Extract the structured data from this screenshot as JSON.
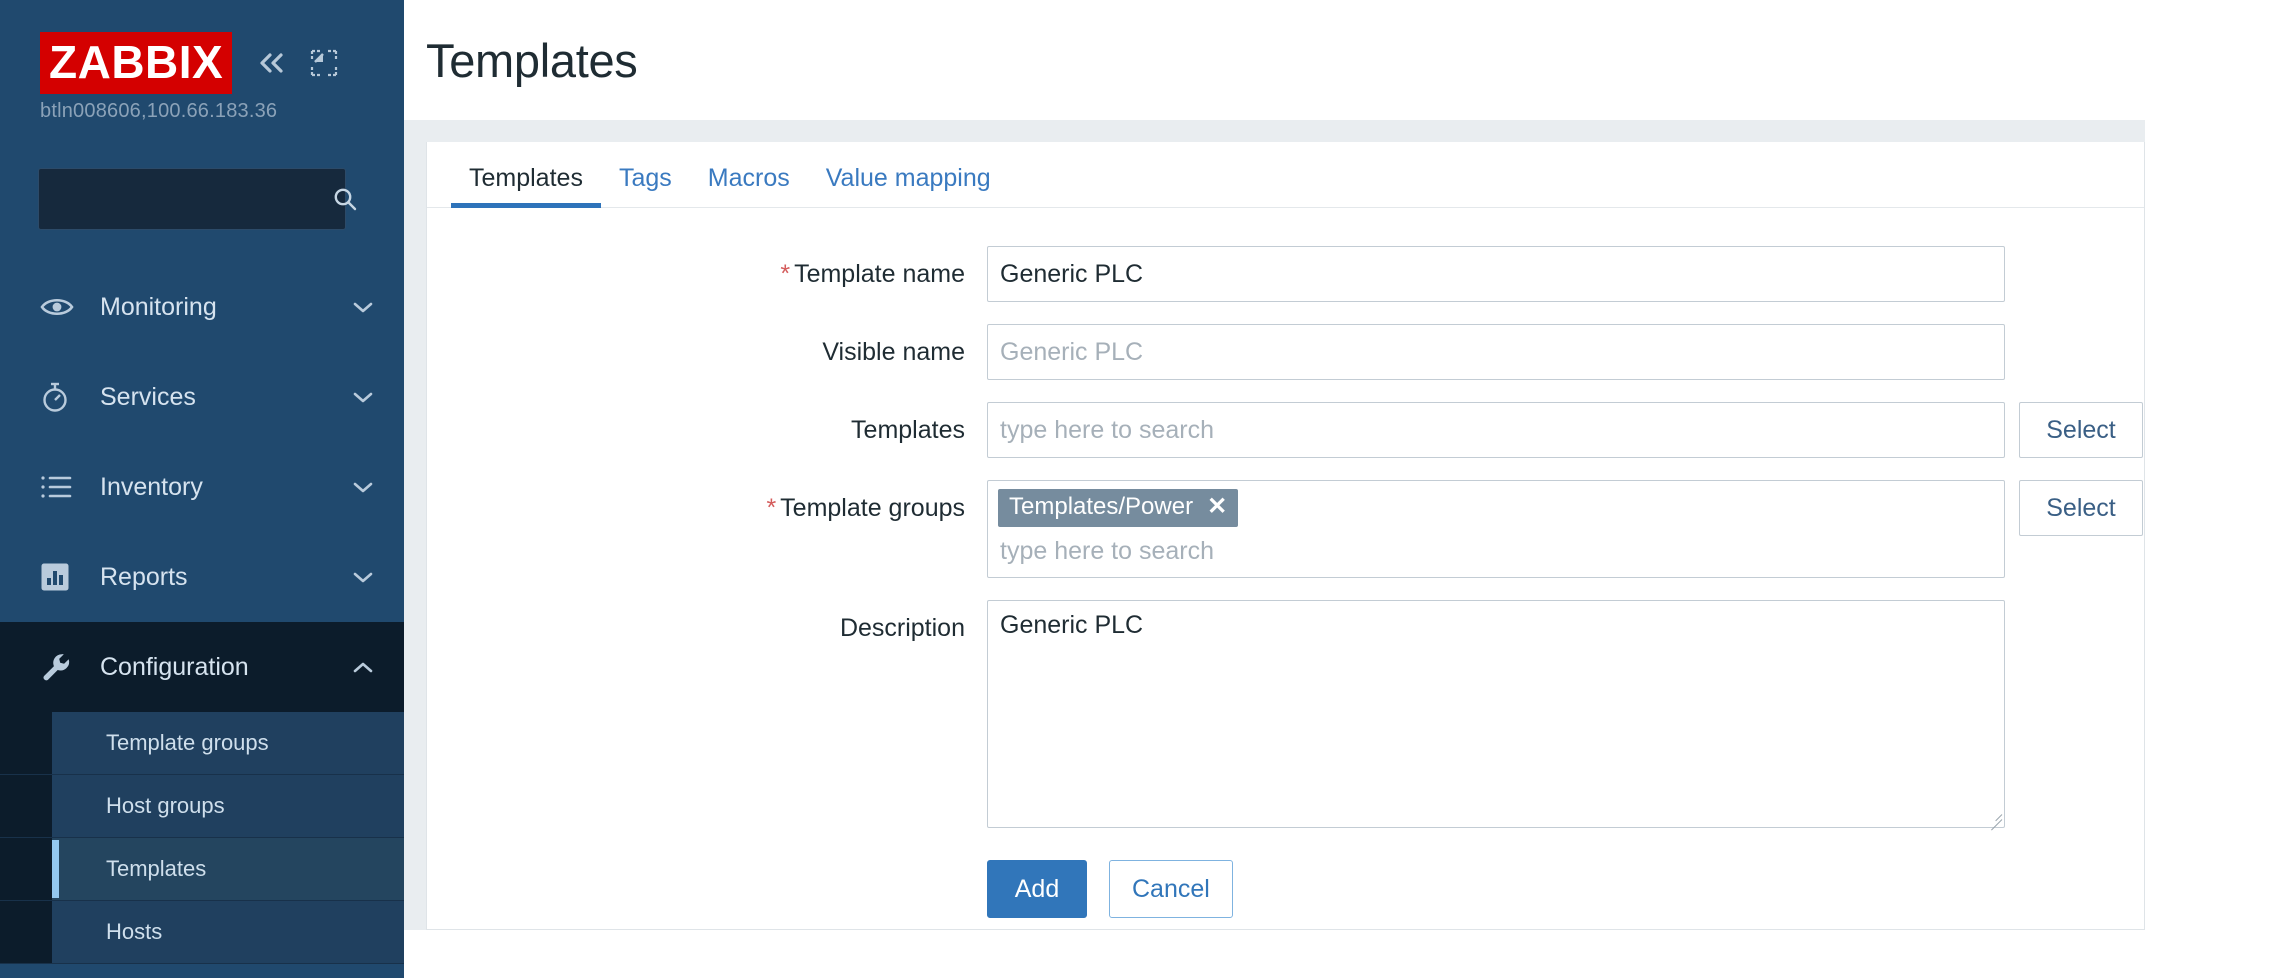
{
  "sidebar": {
    "logo_text": "ZABBIX",
    "host_info": "btln008606,100.66.183.36",
    "search_placeholder": "",
    "search_value": "",
    "collapse_icon": "chevron-double-left-icon",
    "compact_icon": "compact-view-icon",
    "search_icon": "search-icon",
    "nav": [
      {
        "label": "Monitoring",
        "icon": "eye-icon",
        "chevron": "chevron-down-icon",
        "expanded": false
      },
      {
        "label": "Services",
        "icon": "stopwatch-icon",
        "chevron": "chevron-down-icon",
        "expanded": false
      },
      {
        "label": "Inventory",
        "icon": "list-icon",
        "chevron": "chevron-down-icon",
        "expanded": false
      },
      {
        "label": "Reports",
        "icon": "bar-chart-icon",
        "chevron": "chevron-down-icon",
        "expanded": false
      },
      {
        "label": "Configuration",
        "icon": "wrench-icon",
        "chevron": "chevron-up-icon",
        "expanded": true
      }
    ],
    "submenu": [
      {
        "label": "Template groups",
        "selected": false
      },
      {
        "label": "Host groups",
        "selected": false
      },
      {
        "label": "Templates",
        "selected": true
      },
      {
        "label": "Hosts",
        "selected": false
      }
    ]
  },
  "header": {
    "title": "Templates"
  },
  "tabs": [
    {
      "label": "Templates",
      "active": true
    },
    {
      "label": "Tags",
      "active": false
    },
    {
      "label": "Macros",
      "active": false
    },
    {
      "label": "Value mapping",
      "active": false
    }
  ],
  "form": {
    "template_name": {
      "label": "Template name",
      "required": true,
      "value": "Generic PLC",
      "placeholder": ""
    },
    "visible_name": {
      "label": "Visible name",
      "required": false,
      "value": "",
      "placeholder": "Generic PLC"
    },
    "templates": {
      "label": "Templates",
      "required": false,
      "value": "",
      "placeholder": "type here to search",
      "select_label": "Select"
    },
    "template_groups": {
      "label": "Template groups",
      "required": true,
      "chips": [
        {
          "label": "Templates/Power",
          "remove_icon": "close-icon"
        }
      ],
      "placeholder": "type here to search",
      "select_label": "Select"
    },
    "description": {
      "label": "Description",
      "required": false,
      "value": "Generic PLC",
      "placeholder": ""
    }
  },
  "actions": {
    "add_label": "Add",
    "cancel_label": "Cancel"
  },
  "colors": {
    "sidebar_bg": "#20496e",
    "sidebar_active": "#0c1c2b",
    "accent": "#2e73ba",
    "brand_red": "#d40000",
    "chip_bg": "#768c9e",
    "required_star": "#d45c5c",
    "page_bg": "#e9edf0"
  }
}
